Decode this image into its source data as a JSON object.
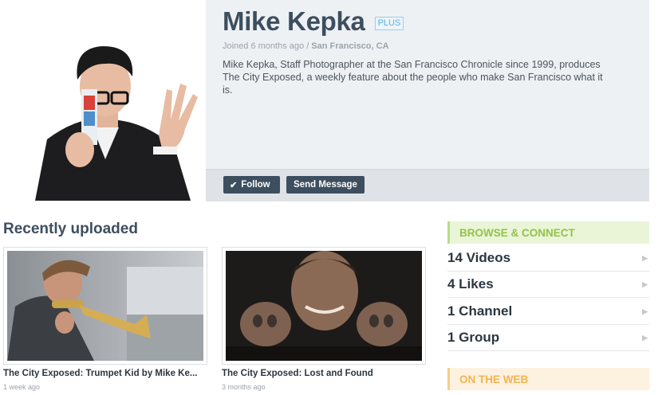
{
  "profile": {
    "name": "Mike Kepka",
    "badge": "PLUS",
    "joined": "Joined 6 months ago",
    "separator": " / ",
    "location": "San Francisco, CA",
    "bio": "Mike Kepka, Staff Photographer at the San Francisco Chronicle since 1999, produces The City Exposed, a weekly feature about the people who make San Francisco what it is."
  },
  "actions": {
    "follow_label": "Follow",
    "message_label": "Send Message"
  },
  "recent": {
    "title": "Recently uploaded",
    "videos": [
      {
        "title": "The City Exposed: Trumpet Kid by Mike Ke...",
        "time": "1 week ago"
      },
      {
        "title": "The City Exposed: Lost and Found",
        "time": "3 months ago"
      }
    ]
  },
  "sidebar": {
    "browse_title": "BROWSE & CONNECT",
    "items": [
      {
        "label": "14 Videos"
      },
      {
        "label": "4 Likes"
      },
      {
        "label": "1 Channel"
      },
      {
        "label": "1 Group"
      }
    ],
    "web_title": "ON THE WEB"
  },
  "colors": {
    "accent_navy": "#3d4e5f",
    "browse_green": "#93c24a",
    "web_orange": "#f2b34f",
    "plus_blue": "#5fb0e0"
  }
}
